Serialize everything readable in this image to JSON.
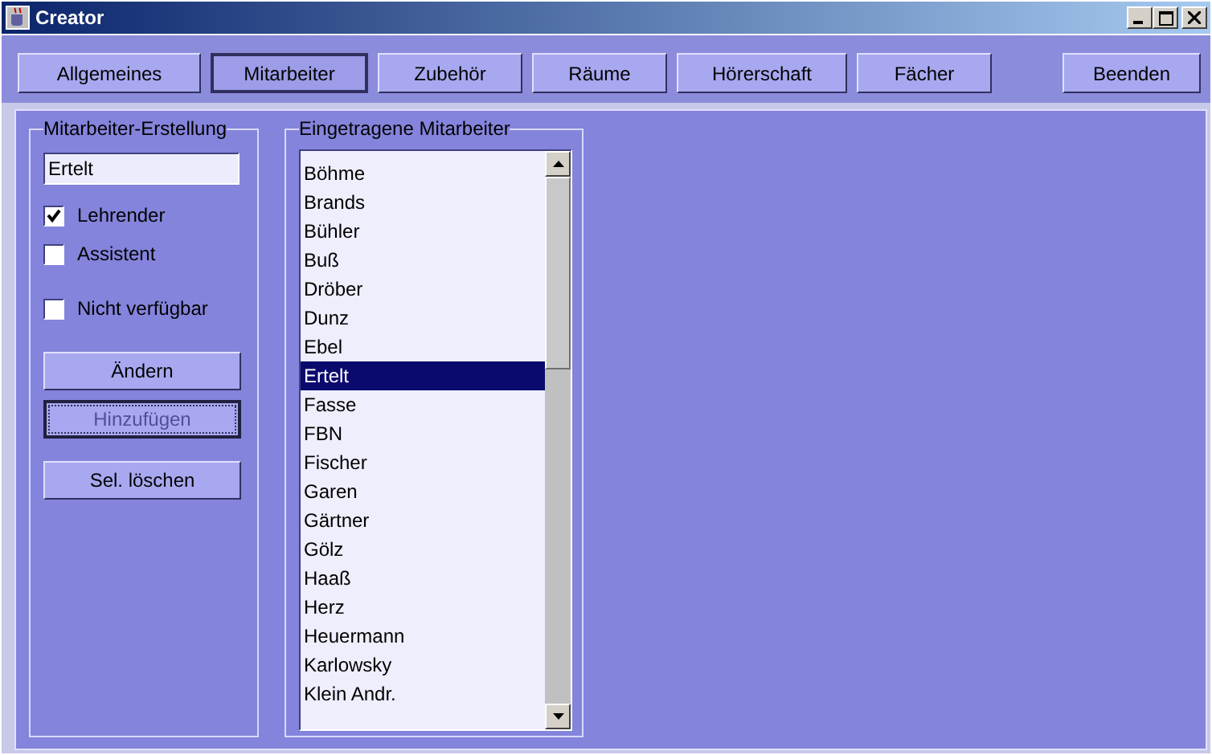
{
  "window": {
    "title": "Creator"
  },
  "tabs": [
    {
      "label": "Allgemeines",
      "selected": false
    },
    {
      "label": "Mitarbeiter",
      "selected": true
    },
    {
      "label": "Zubehör",
      "selected": false
    },
    {
      "label": "Räume",
      "selected": false
    },
    {
      "label": "Hörerschaft",
      "selected": false
    },
    {
      "label": "Fächer",
      "selected": false
    }
  ],
  "exit_button": "Beenden",
  "creation": {
    "title": "Mitarbeiter-Erstellung",
    "name_value": "Ertelt",
    "options": [
      {
        "label": "Lehrender",
        "checked": true
      },
      {
        "label": "Assistent",
        "checked": false
      },
      {
        "label": "Nicht verfügbar",
        "checked": false
      }
    ],
    "buttons": [
      {
        "label": "Ändern",
        "disabled": false
      },
      {
        "label": "Hinzufügen",
        "disabled": true
      },
      {
        "label": "Sel. löschen",
        "disabled": false
      }
    ]
  },
  "staff": {
    "title": "Eingetragene Mitarbeiter",
    "items": [
      {
        "name": "Böhme",
        "selected": false
      },
      {
        "name": "Brands",
        "selected": false
      },
      {
        "name": "Bühler",
        "selected": false
      },
      {
        "name": "Buß",
        "selected": false
      },
      {
        "name": "Dröber",
        "selected": false
      },
      {
        "name": "Dunz",
        "selected": false
      },
      {
        "name": "Ebel",
        "selected": false
      },
      {
        "name": "Ertelt",
        "selected": true
      },
      {
        "name": "Fasse",
        "selected": false
      },
      {
        "name": "FBN",
        "selected": false
      },
      {
        "name": "Fischer",
        "selected": false
      },
      {
        "name": "Garen",
        "selected": false
      },
      {
        "name": "Gärtner",
        "selected": false
      },
      {
        "name": "Gölz",
        "selected": false
      },
      {
        "name": "Haaß",
        "selected": false
      },
      {
        "name": "Herz",
        "selected": false
      },
      {
        "name": "Heuermann",
        "selected": false
      },
      {
        "name": "Karlowsky",
        "selected": false
      },
      {
        "name": "Klein Andr.",
        "selected": false
      }
    ]
  }
}
